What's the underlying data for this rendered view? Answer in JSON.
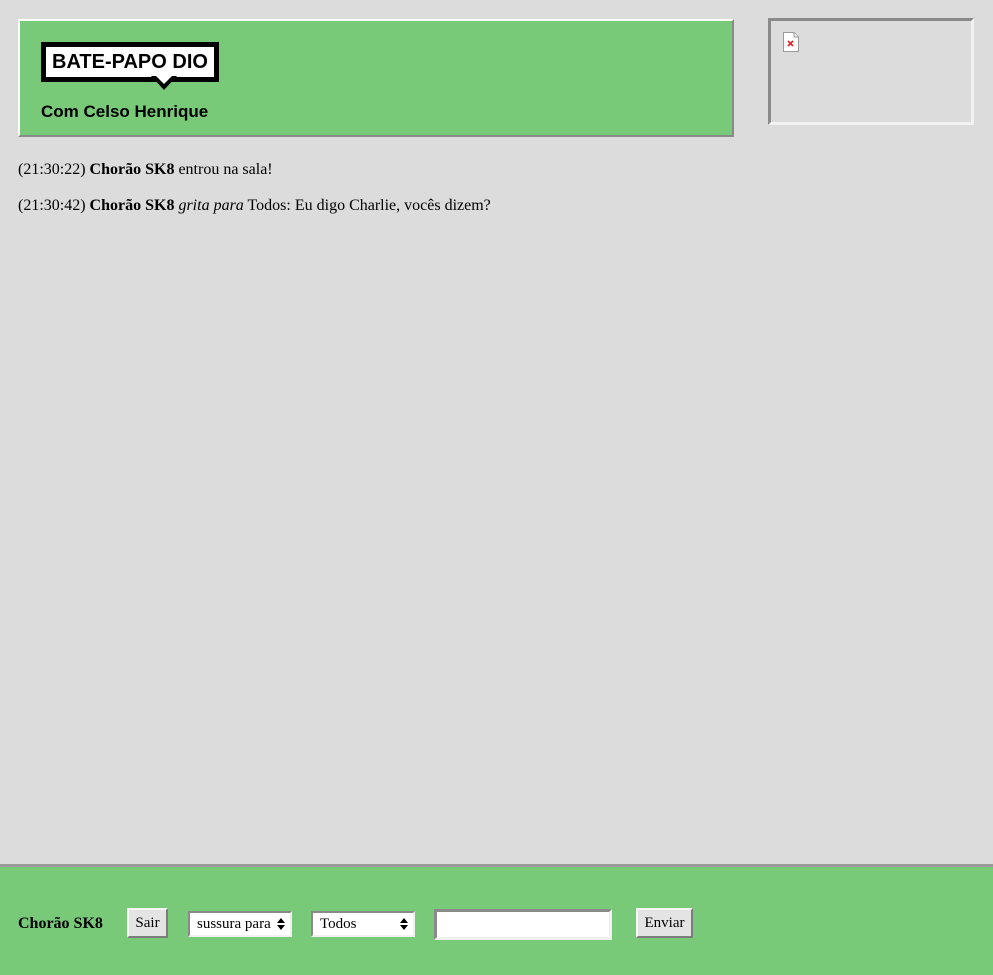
{
  "header": {
    "logo_text": "BATE-PAPO DIO",
    "subtitle": "Com Celso Henrique"
  },
  "side_panel": {
    "image_icon": "broken-image-icon"
  },
  "messages": [
    {
      "time": "(21:30:22)",
      "user": "Chorão SK8",
      "action": "",
      "text": "entrou na sala!"
    },
    {
      "time": "(21:30:42)",
      "user": "Chorão SK8",
      "action": "grita para",
      "text": "Todos: Eu digo Charlie, vocês dizem?"
    }
  ],
  "footer": {
    "username": "Chorão SK8",
    "exit_label": "Sair",
    "mode_selected": "sussura para",
    "target_selected": "Todos",
    "message_value": "",
    "send_label": "Enviar"
  },
  "colors": {
    "background": "#dcdcdc",
    "accent_green": "#78c978"
  }
}
